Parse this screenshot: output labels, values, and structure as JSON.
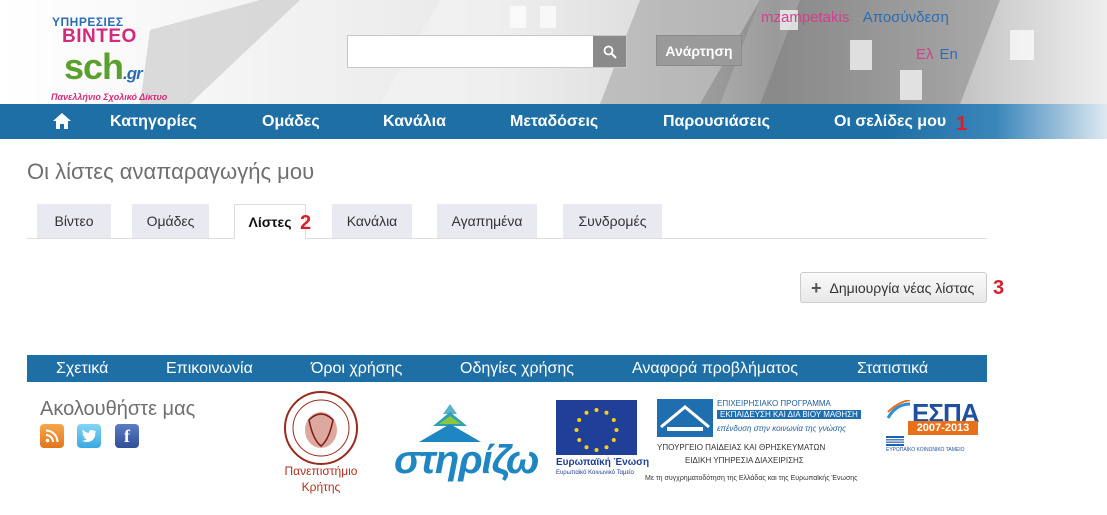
{
  "logo": {
    "line1": "ΥΠΗΡΕΣΙΕΣ",
    "line2": "ΒΙΝΤΕΟ",
    "line3": "sch",
    "line3_suffix": ".gr",
    "tagline": "Πανελλήνιο Σχολικό Δίκτυο"
  },
  "search": {
    "placeholder": "",
    "value": ""
  },
  "header": {
    "upload_label": "Ανάρτηση",
    "username": "mzampetakis",
    "separator": " - ",
    "logout_label": "Αποσύνδεση",
    "lang_el": "Ελ",
    "lang_en": "En"
  },
  "nav": {
    "items": [
      "Κατηγορίες",
      "Ομάδες",
      "Κανάλια",
      "Μεταδόσεις",
      "Παρουσιάσεις",
      "Οι σελίδες μου"
    ]
  },
  "annotations": [
    "1",
    "2",
    "3"
  ],
  "page": {
    "title": "Οι λίστες αναπαραγωγής μου"
  },
  "tabs": [
    "Βίντεο",
    "Ομάδες",
    "Λίστες",
    "Κανάλια",
    "Αγαπημένα",
    "Συνδρομές"
  ],
  "active_tab": "Λίστες",
  "actions": {
    "create_playlist_label": "Δημιουργία νέας λίστας"
  },
  "footer": {
    "links": [
      "Σχετικά",
      "Επικοινωνία",
      "Όροι χρήσης",
      "Οδηγίες χρήσης",
      "Αναφορά προβλήματος",
      "Στατιστικά"
    ],
    "follow_label": "Ακολουθήστε μας",
    "social": [
      "rss-icon",
      "twitter-icon",
      "facebook-icon"
    ]
  },
  "partners": {
    "uoc_line1": "Πανεπιστήμιο",
    "uoc_line2": "Κρήτης",
    "stirizo": "στηρίζω",
    "eu_title": "Ευρωπαϊκή Ένωση",
    "eu_sub": "Ευρωπαϊκό Κοινωνικό Ταμείο",
    "edu_line1": "ΕΠΙΧΕΙΡΗΣΙΑΚΟ ΠΡΟΓΡΑΜΜΑ",
    "edu_line2": "ΕΚΠΑΙΔΕΥΣΗ ΚΑΙ ΔΙΑ ΒΙΟΥ ΜΑΘΗΣΗ",
    "edu_line3": "επένδυση στην κοινωνία της γνώσης",
    "edu_line4": "ΥΠΟΥΡΓΕΙΟ ΠΑΙΔΕΙΑΣ ΚΑΙ ΘΡΗΣΚΕΥΜΑΤΩΝ",
    "edu_line5": "ΕΙΔΙΚΗ ΥΠΗΡΕΣΙΑ ΔΙΑΧΕΙΡΙΣΗΣ",
    "cofund": "Με τη συγχρηματοδότηση της Ελλάδας και της Ευρωπαϊκής Ένωσης",
    "espa_title": "ΕΣΠΑ",
    "espa_years": "2007-2013",
    "espa_sub": "ΕΥΡΩΠΑΪΚΟ ΚΟΙΝΩΝΙΚΟ ΤΑΜΕΙΟ"
  },
  "colors": {
    "nav_blue": "#1e6fa5",
    "accent_pink": "#d43f8d",
    "annotation_red": "#d8202a"
  }
}
